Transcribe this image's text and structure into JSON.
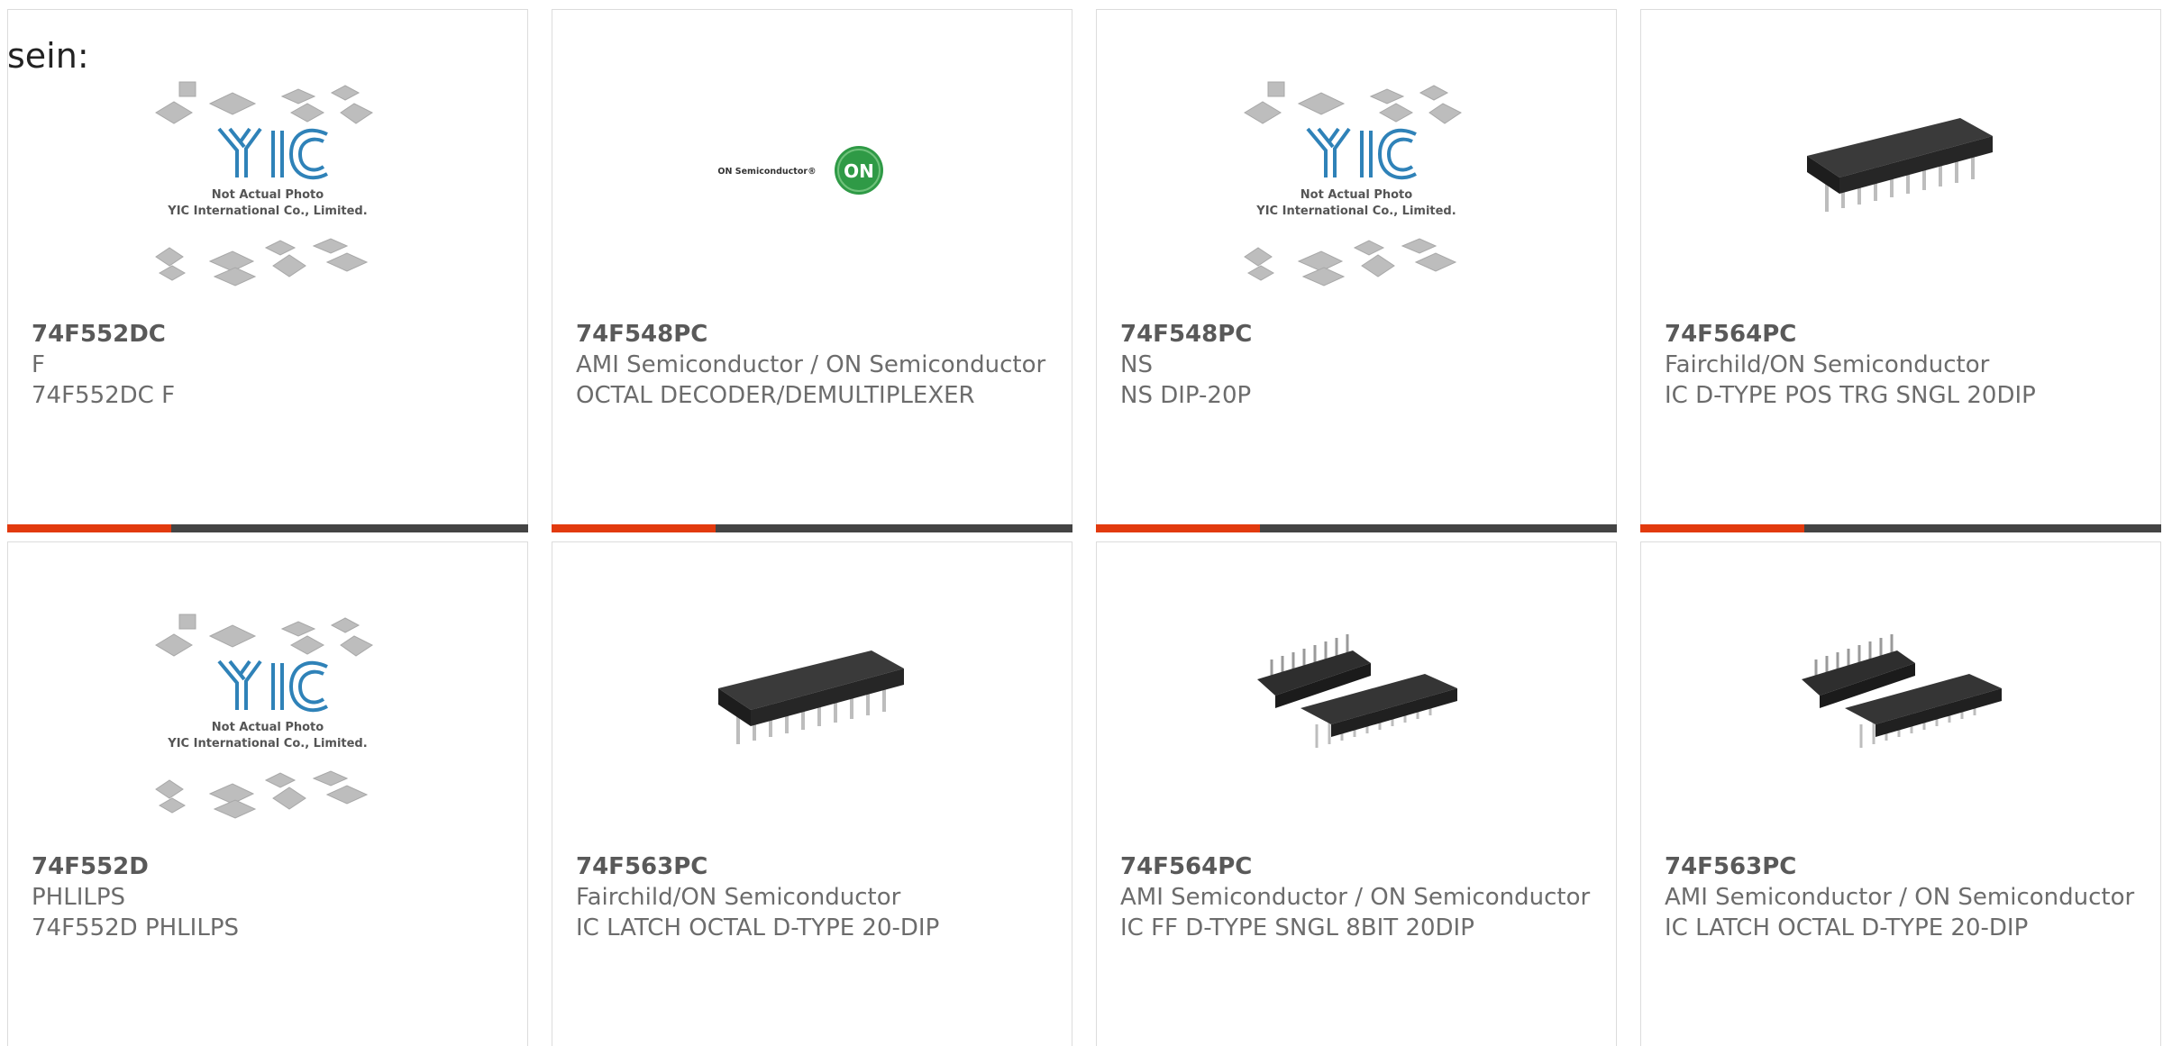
{
  "heading": "sein:",
  "colors": {
    "accent": "#e23a0e",
    "bar": "#444444",
    "text": "#666666",
    "border": "#dcdcdc"
  },
  "cards": [
    {
      "part": "74F552DC",
      "maker": "F",
      "desc": "74F552DC F",
      "image": "placeholder-photo",
      "placeholder_line1": "Not Actual Photo",
      "placeholder_line2": "YIC International Co., Limited."
    },
    {
      "part": "74F548PC",
      "maker": "AMI Semiconductor / ON Semiconductor",
      "desc": "OCTAL DECODER/DEMULTIPLEXER",
      "image": "on-semi-logo",
      "logo_text": "ON Semiconductor®"
    },
    {
      "part": "74F548PC",
      "maker": "NS",
      "desc": "NS DIP-20P",
      "image": "placeholder-photo",
      "placeholder_line1": "Not Actual Photo",
      "placeholder_line2": "YIC International Co., Limited."
    },
    {
      "part": "74F564PC",
      "maker": "Fairchild/ON Semiconductor",
      "desc": "IC D-TYPE POS TRG SNGL 20DIP",
      "image": "dip-chip-photo"
    },
    {
      "part": "74F552D",
      "maker": "PHLILPS",
      "desc": "74F552D PHLILPS",
      "image": "placeholder-photo",
      "placeholder_line1": "Not Actual Photo",
      "placeholder_line2": "YIC International Co., Limited."
    },
    {
      "part": "74F563PC",
      "maker": "Fairchild/ON Semiconductor",
      "desc": "IC LATCH OCTAL D-TYPE 20-DIP",
      "image": "dip-chip-photo"
    },
    {
      "part": "74F564PC",
      "maker": "AMI Semiconductor / ON Semiconductor",
      "desc": "IC FF D-TYPE SNGL 8BIT 20DIP",
      "image": "two-dip-chips-photo"
    },
    {
      "part": "74F563PC",
      "maker": "AMI Semiconductor / ON Semiconductor",
      "desc": "IC LATCH OCTAL D-TYPE 20-DIP",
      "image": "two-dip-chips-photo"
    }
  ]
}
